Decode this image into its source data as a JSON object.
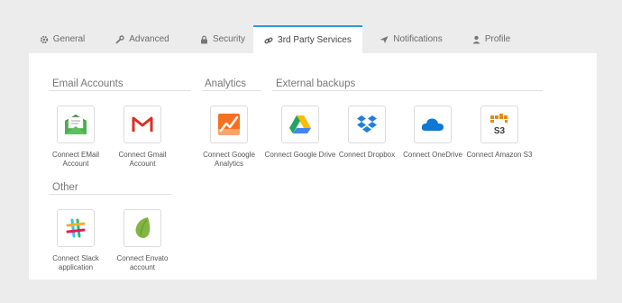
{
  "tabs": [
    {
      "label": "General",
      "icon": "gear-icon"
    },
    {
      "label": "Advanced",
      "icon": "wrench-icon"
    },
    {
      "label": "Security",
      "icon": "lock-icon"
    },
    {
      "label": "3rd Party Services",
      "icon": "link-icon",
      "active": true
    },
    {
      "label": "Notifications",
      "icon": "paper-plane-icon"
    },
    {
      "label": "Profile",
      "icon": "user-icon"
    }
  ],
  "sections": {
    "email": {
      "title": "Email Accounts",
      "items": [
        {
          "label": "Connect EMail Account",
          "icon": "email-envelope-icon"
        },
        {
          "label": "Connect Gmail Account",
          "icon": "gmail-icon"
        }
      ]
    },
    "analytics": {
      "title": "Analytics",
      "items": [
        {
          "label": "Connect Google Analytics",
          "icon": "google-analytics-icon"
        }
      ]
    },
    "backups": {
      "title": "External backups",
      "items": [
        {
          "label": "Connect Google Drive",
          "icon": "google-drive-icon"
        },
        {
          "label": "Connect Dropbox",
          "icon": "dropbox-icon"
        },
        {
          "label": "Connect OneDrive",
          "icon": "onedrive-icon"
        },
        {
          "label": "Connect Amazon S3",
          "icon": "amazon-s3-icon",
          "badge": "S3"
        }
      ]
    },
    "other": {
      "title": "Other",
      "items": [
        {
          "label": "Connect Slack application",
          "icon": "slack-icon"
        },
        {
          "label": "Connect Envato account",
          "icon": "envato-icon"
        }
      ]
    }
  },
  "colors": {
    "accent": "#2a9fd8",
    "gmail_red": "#d93025",
    "analytics_orange": "#f4711f",
    "dropbox_blue": "#1f7fe0",
    "onedrive_blue": "#0f78d4",
    "s3_orange": "#e68a1e",
    "envato_green": "#82b541"
  }
}
